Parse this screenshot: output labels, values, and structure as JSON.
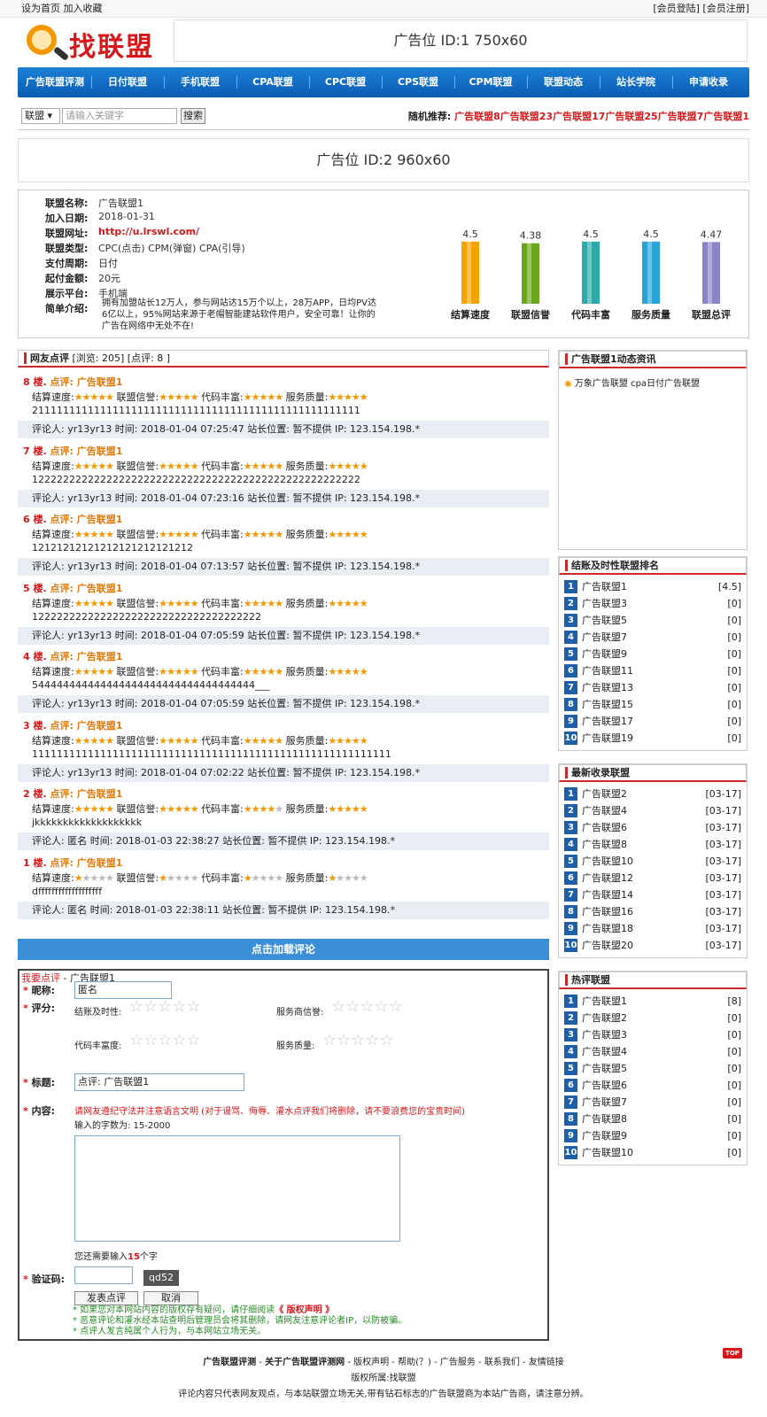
{
  "topbar": {
    "left": "设为首页 加入收藏",
    "right": "[会员登陆] [会员注册]"
  },
  "logo": {
    "text": "找联盟"
  },
  "ad_top": "广告位 ID:1 750x60",
  "nav": [
    "广告联盟评测",
    "日付联盟",
    "手机联盟",
    "CPA联盟",
    "CPC联盟",
    "CPS联盟",
    "CPM联盟",
    "联盟动态",
    "站长学院",
    "申请收录"
  ],
  "search": {
    "select": "联盟 ▾",
    "placeholder": "请输入关键字",
    "button": "搜索",
    "random_label": "随机推荐:",
    "random_links": "广告联盟8广告联盟23广告联盟17广告联盟25广告联盟7广告联盟1"
  },
  "ad_mid": "广告位 ID:2 960x60",
  "info": {
    "fields": [
      {
        "k": "联盟名称:",
        "v": "广告联盟1"
      },
      {
        "k": "加入日期:",
        "v": "2018-01-31"
      },
      {
        "k": "联盟网址:",
        "v": "http://u.lrswl.com/"
      },
      {
        "k": "联盟类型:",
        "v": "CPC(点击) CPM(弹窗) CPA(引导)"
      },
      {
        "k": "支付周期:",
        "v": "日付"
      },
      {
        "k": "起付金额:",
        "v": "20元"
      },
      {
        "k": "展示平台:",
        "v": "手机端"
      },
      {
        "k": "简单介绍:",
        "v": ""
      }
    ],
    "intro": "拥有加盟站长12万人，参与网站达15万个以上，28万APP，日均PV达6亿以上，95%网站来源于老帽智能建站软件用户，安全可靠！让你的广告在网络中无处不在!"
  },
  "chart_data": {
    "type": "bar",
    "categories": [
      "结算速度",
      "联盟信誉",
      "代码丰富",
      "服务质量",
      "联盟总评"
    ],
    "values": [
      4.5,
      4.38,
      4.5,
      4.5,
      4.47
    ],
    "colors": [
      "#f5a300",
      "#6aa61c",
      "#2eaaa8",
      "#28a3d8",
      "#8a84c8"
    ],
    "ylim": [
      0,
      5
    ]
  },
  "comments_header": {
    "title": "网友点评",
    "stats": "[浏览: 205] [点评: 8 ]"
  },
  "rating_labels": [
    "结算速度:",
    "联盟信誉:",
    "代码丰富:",
    "服务质量:"
  ],
  "comments": [
    {
      "floor": "8 楼.",
      "title": "点评: 广告联盟1",
      "stars": [
        5,
        5,
        5,
        5
      ],
      "body": "21111111111111111111111111111111111111111111111111111",
      "meta": "评论人: yr13yr13 时间: 2018-01-04 07:25:47 站长位置: 暂不提供 IP: 123.154.198.*"
    },
    {
      "floor": "7 楼.",
      "title": "点评: 广告联盟1",
      "stars": [
        5,
        5,
        5,
        5
      ],
      "body": "12222222222222222222222222222222222222222222222222222",
      "meta": "评论人: yr13yr13 时间: 2018-01-04 07:23:16 站长位置: 暂不提供 IP: 123.154.198.*"
    },
    {
      "floor": "6 楼.",
      "title": "点评: 广告联盟1",
      "stars": [
        5,
        5,
        5,
        5
      ],
      "body": "12121212121212121212121212",
      "meta": "评论人: yr13yr13 时间: 2018-01-04 07:13:57 站长位置: 暂不提供 IP: 123.154.198.*"
    },
    {
      "floor": "5 楼.",
      "title": "点评: 广告联盟1",
      "stars": [
        5,
        5,
        5,
        5
      ],
      "body": "1222222222222222222222222222222222222",
      "meta": "评论人: yr13yr13 时间: 2018-01-04 07:05:59 站长位置: 暂不提供 IP: 123.154.198.*"
    },
    {
      "floor": "4 楼.",
      "title": "点评: 广告联盟1",
      "stars": [
        5,
        5,
        5,
        5
      ],
      "body": "544444444444444444444444444444444444___",
      "meta": "评论人: yr13yr13 时间: 2018-01-04 07:05:59 站长位置: 暂不提供 IP: 123.154.198.*"
    },
    {
      "floor": "3 楼.",
      "title": "点评: 广告联盟1",
      "stars": [
        5,
        5,
        5,
        5
      ],
      "body": "1111111111111111111111111111111111111111111111111111111111",
      "meta": "评论人: yr13yr13 时间: 2018-01-04 07:02:22 站长位置: 暂不提供 IP: 123.154.198.*"
    },
    {
      "floor": "2 楼.",
      "title": "点评: 广告联盟1",
      "stars": [
        5,
        5,
        4,
        5
      ],
      "body": "jkkkkkkkkkkkkkkkkkkk",
      "meta": "评论人: 匿名 时间: 2018-01-03 22:38:27 站长位置: 暂不提供 IP: 123.154.198.*"
    },
    {
      "floor": "1 楼.",
      "title": "点评: 广告联盟1",
      "stars": [
        1,
        1,
        1,
        1
      ],
      "body": "dfffffffffffffffffff",
      "meta": "评论人: 匿名 时间: 2018-01-03 22:38:11 站长位置: 暂不提供 IP: 123.154.198.*"
    }
  ],
  "load_more": "点击加载评论",
  "form": {
    "title_link": "我要点评",
    "title_rest": " - 广告联盟1",
    "nick_label": "昵称:",
    "nick_value": "匿名",
    "score_label": "评分:",
    "score_items": [
      "结账及时性:",
      "服务商信誉:",
      "代码丰富度:",
      "服务质量:"
    ],
    "subject_label": "标题:",
    "subject_value": "点评: 广告联盟1",
    "content_label": "内容:",
    "warn": "请网友遵纪守法并注意语言文明 (对于谩骂、侮辱、灌水点评我们将删除，请不要浪费您的宝贵时间)",
    "length_hint": "输入的字数为: 15-2000",
    "remain_pre": "您还需要输入",
    "remain_num": "15",
    "remain_post": "个字",
    "captcha_label": "验证码:",
    "captcha": "qd52",
    "submit": "发表点评",
    "cancel": "取消",
    "note1_pre": "* 如果您对本网站内容的版权存有疑问，请仔细阅读",
    "note1_link": "《 版权声明 》",
    "note2": "* 恶意评论和灌水经本站查明后管理员会将其删除，请网友注意评论者IP，以防被骗。",
    "note3": "* 点评人发言纯属个人行为，与本网站立场无关。"
  },
  "news": {
    "title": "广告联盟1动态资讯",
    "items": [
      "万象广告联盟 cpa日付广告联盟"
    ]
  },
  "ranking": {
    "title": "结账及时性联盟排名",
    "items": [
      {
        "n": "1",
        "name": "广告联盟1",
        "v": "[4.5]"
      },
      {
        "n": "2",
        "name": "广告联盟3",
        "v": "[0]"
      },
      {
        "n": "3",
        "name": "广告联盟5",
        "v": "[0]"
      },
      {
        "n": "4",
        "name": "广告联盟7",
        "v": "[0]"
      },
      {
        "n": "5",
        "name": "广告联盟9",
        "v": "[0]"
      },
      {
        "n": "6",
        "name": "广告联盟11",
        "v": "[0]"
      },
      {
        "n": "7",
        "name": "广告联盟13",
        "v": "[0]"
      },
      {
        "n": "8",
        "name": "广告联盟15",
        "v": "[0]"
      },
      {
        "n": "9",
        "name": "广告联盟17",
        "v": "[0]"
      },
      {
        "n": "10",
        "name": "广告联盟19",
        "v": "[0]"
      }
    ]
  },
  "latest": {
    "title": "最新收录联盟",
    "items": [
      {
        "n": "1",
        "name": "广告联盟2",
        "v": "[03-17]"
      },
      {
        "n": "2",
        "name": "广告联盟4",
        "v": "[03-17]"
      },
      {
        "n": "3",
        "name": "广告联盟6",
        "v": "[03-17]"
      },
      {
        "n": "4",
        "name": "广告联盟8",
        "v": "[03-17]"
      },
      {
        "n": "5",
        "name": "广告联盟10",
        "v": "[03-17]"
      },
      {
        "n": "6",
        "name": "广告联盟12",
        "v": "[03-17]"
      },
      {
        "n": "7",
        "name": "广告联盟14",
        "v": "[03-17]"
      },
      {
        "n": "8",
        "name": "广告联盟16",
        "v": "[03-17]"
      },
      {
        "n": "9",
        "name": "广告联盟18",
        "v": "[03-17]"
      },
      {
        "n": "10",
        "name": "广告联盟20",
        "v": "[03-17]"
      }
    ]
  },
  "hot": {
    "title": "热评联盟",
    "items": [
      {
        "n": "1",
        "name": "广告联盟1",
        "v": "[8]"
      },
      {
        "n": "2",
        "name": "广告联盟2",
        "v": "[0]"
      },
      {
        "n": "3",
        "name": "广告联盟3",
        "v": "[0]"
      },
      {
        "n": "4",
        "name": "广告联盟4",
        "v": "[0]"
      },
      {
        "n": "5",
        "name": "广告联盟5",
        "v": "[0]"
      },
      {
        "n": "6",
        "name": "广告联盟6",
        "v": "[0]"
      },
      {
        "n": "7",
        "name": "广告联盟7",
        "v": "[0]"
      },
      {
        "n": "8",
        "name": "广告联盟8",
        "v": "[0]"
      },
      {
        "n": "9",
        "name": "广告联盟9",
        "v": "[0]"
      },
      {
        "n": "10",
        "name": "广告联盟10",
        "v": "[0]"
      }
    ]
  },
  "footer": {
    "links": [
      "广告联盟评测",
      "关于广告联盟评测网",
      "版权声明",
      "帮助(？)",
      "广告服务",
      "联系我们",
      "友情链接"
    ],
    "copyright": "版权所属:找联盟",
    "disclaimer": "评论内容只代表网友观点，与本站联盟立场无关,带有钻石标志的广告联盟商为本站广告商，请注意分辨。",
    "top": "TOP"
  }
}
